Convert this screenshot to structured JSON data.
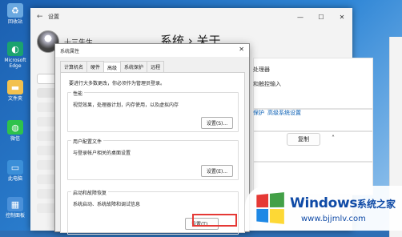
{
  "desktop_icons": [
    {
      "label": "回收站",
      "icon": "recycle-bin-icon",
      "glyph": "♻",
      "color": "#6aa8e0"
    },
    {
      "label": "Microsoft Edge",
      "icon": "edge-icon",
      "glyph": "◐",
      "color": "#1aa36f"
    },
    {
      "label": "文件夹",
      "icon": "folder-icon",
      "glyph": "▬",
      "color": "#f2c14e"
    },
    {
      "label": "微信",
      "icon": "wechat-icon",
      "glyph": "◍",
      "color": "#2ec24b"
    },
    {
      "label": "此电脑",
      "icon": "computer-icon",
      "glyph": "▭",
      "color": "#3b8fd8"
    },
    {
      "label": "控制面板",
      "icon": "control-panel-icon",
      "glyph": "▦",
      "color": "#4a90d9"
    }
  ],
  "settings": {
    "title": "设置",
    "user_name": "十三先生",
    "page_title": "系统 › 关于",
    "right": {
      "processor": "处理器",
      "pen_touch": "和触控输入",
      "protection_link": "保护",
      "advanced_link": "高级系统设置",
      "copy_button": "复制"
    }
  },
  "dialog": {
    "title": "系统属性",
    "close_glyph": "✕",
    "tabs": [
      "计算机名",
      "硬件",
      "高级",
      "系统保护",
      "远程"
    ],
    "active_tab": 2,
    "note": "要进行大多数更改，你必须作为管理员登录。",
    "performance": {
      "label": "性能",
      "desc": "视觉效果，处理器计划，内存使用，以及虚拟内存",
      "button": "设置(S)..."
    },
    "profile": {
      "label": "用户配置文件",
      "desc": "与登录帐户相关的桌面设置",
      "button": "设置(E)..."
    },
    "startup": {
      "label": "启动和故障恢复",
      "desc": "系统启动、系统故障和调试信息",
      "button": "设置(T)..."
    }
  },
  "watermark": {
    "title": "Windows",
    "subtitle": "系统之家",
    "url": "www.bjjmlv.com",
    "logo_colors": [
      "#e53935",
      "#43a047",
      "#1e88e5",
      "#fdd835"
    ]
  }
}
